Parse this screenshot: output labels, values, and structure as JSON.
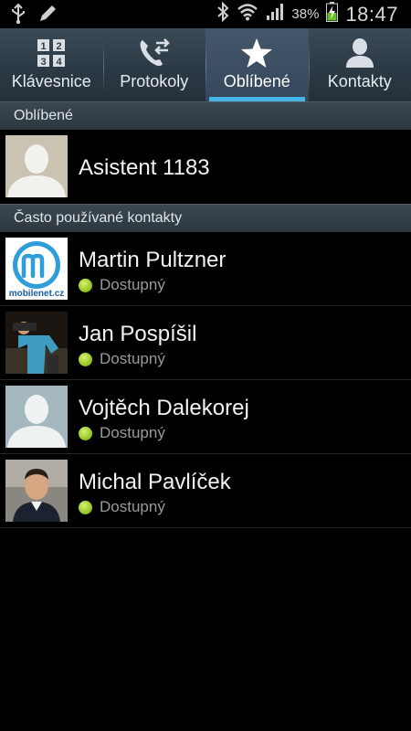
{
  "status_bar": {
    "battery_percent": "38%",
    "time": "18:47",
    "icons": [
      "usb-icon",
      "pencil-icon",
      "bluetooth-icon",
      "wifi-icon",
      "signal-icon",
      "battery-charging-icon"
    ]
  },
  "tabs": [
    {
      "label": "Klávesnice",
      "icon": "keypad-icon",
      "active": false
    },
    {
      "label": "Protokoly",
      "icon": "call-log-icon",
      "active": false
    },
    {
      "label": "Oblíbené",
      "icon": "star-icon",
      "active": true
    },
    {
      "label": "Kontakty",
      "icon": "person-icon",
      "active": false
    }
  ],
  "favorites": {
    "header": "Oblíbené",
    "items": [
      {
        "name": "Asistent 1183"
      }
    ]
  },
  "frequent": {
    "header": "Často používané kontakty",
    "items": [
      {
        "name": "Martin Pultzner",
        "status": "Dostupný",
        "avatar": "mobilenet-logo"
      },
      {
        "name": "Jan Pospíšil",
        "status": "Dostupný",
        "avatar": "photo"
      },
      {
        "name": "Vojtěch Dalekorej",
        "status": "Dostupný",
        "avatar": "placeholder"
      },
      {
        "name": "Michal Pavlíček",
        "status": "Dostupný",
        "avatar": "photo"
      }
    ],
    "logo_text": "mobilenet.cz"
  },
  "colors": {
    "accent": "#44b4e4",
    "available": "#8ec21c"
  }
}
